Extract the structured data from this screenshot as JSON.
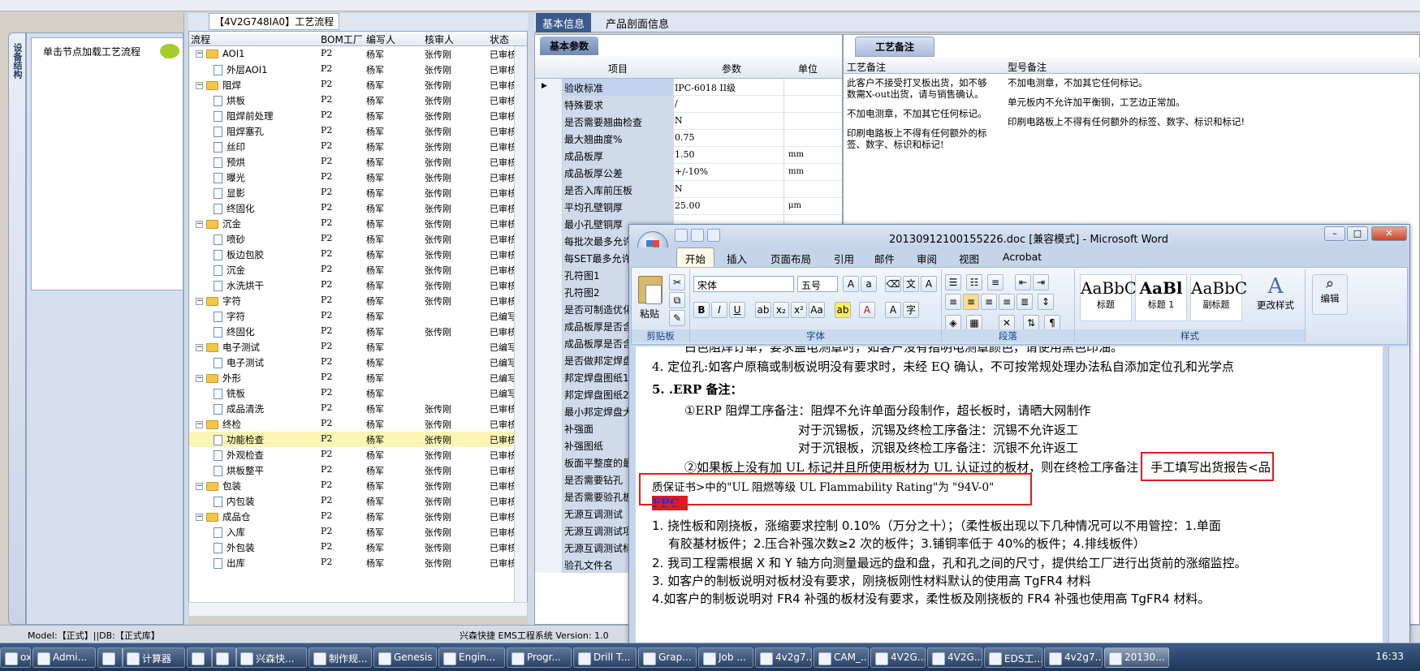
{
  "tree_caption": "【4V2G748IA0】工艺流程",
  "left_tab": "设备结构",
  "hint": "单击节点加载工艺流程",
  "tree_headers": [
    "流程",
    "BOM工厂",
    "编写人",
    "核审人",
    "状态"
  ],
  "tree_rows": [
    {
      "name": "AOI1",
      "type": "folder",
      "bom": "P2",
      "writer": "杨军",
      "reviewer": "张传刚",
      "status": "已审核"
    },
    {
      "name": "外层AOI1",
      "type": "doc",
      "bom": "P2",
      "writer": "杨军",
      "reviewer": "张传刚",
      "status": "已审核"
    },
    {
      "name": "阻焊",
      "type": "folder",
      "bom": "P2",
      "writer": "杨军",
      "reviewer": "张传刚",
      "status": "已审核"
    },
    {
      "name": "烘板",
      "type": "doc",
      "bom": "P2",
      "writer": "杨军",
      "reviewer": "张传刚",
      "status": "已审核"
    },
    {
      "name": "阻焊前处理",
      "type": "doc",
      "bom": "P2",
      "writer": "杨军",
      "reviewer": "张传刚",
      "status": "已审核"
    },
    {
      "name": "阻焊塞孔",
      "type": "doc",
      "bom": "P2",
      "writer": "杨军",
      "reviewer": "张传刚",
      "status": "已审核"
    },
    {
      "name": "丝印",
      "type": "doc",
      "bom": "P2",
      "writer": "杨军",
      "reviewer": "张传刚",
      "status": "已审核"
    },
    {
      "name": "预烘",
      "type": "doc",
      "bom": "P2",
      "writer": "杨军",
      "reviewer": "张传刚",
      "status": "已审核"
    },
    {
      "name": "曝光",
      "type": "doc",
      "bom": "P2",
      "writer": "杨军",
      "reviewer": "张传刚",
      "status": "已审核"
    },
    {
      "name": "显影",
      "type": "doc",
      "bom": "P2",
      "writer": "杨军",
      "reviewer": "张传刚",
      "status": "已审核"
    },
    {
      "name": "终固化",
      "type": "doc",
      "bom": "P2",
      "writer": "杨军",
      "reviewer": "张传刚",
      "status": "已审核"
    },
    {
      "name": "沉金",
      "type": "folder",
      "bom": "P2",
      "writer": "杨军",
      "reviewer": "张传刚",
      "status": "已审核"
    },
    {
      "name": "喷砂",
      "type": "doc",
      "bom": "P2",
      "writer": "杨军",
      "reviewer": "张传刚",
      "status": "已审核"
    },
    {
      "name": "板边包胶",
      "type": "doc",
      "bom": "P2",
      "writer": "杨军",
      "reviewer": "张传刚",
      "status": "已审核"
    },
    {
      "name": "沉金",
      "type": "doc",
      "bom": "P2",
      "writer": "杨军",
      "reviewer": "张传刚",
      "status": "已审核"
    },
    {
      "name": "水洗烘干",
      "type": "doc",
      "bom": "P2",
      "writer": "杨军",
      "reviewer": "张传刚",
      "status": "已审核"
    },
    {
      "name": "字符",
      "type": "folder",
      "bom": "P2",
      "writer": "杨军",
      "reviewer": "张传刚",
      "status": "已审核"
    },
    {
      "name": "字符",
      "type": "doc",
      "bom": "P2",
      "writer": "杨军",
      "reviewer": "",
      "status": "已编写"
    },
    {
      "name": "终固化",
      "type": "doc",
      "bom": "P2",
      "writer": "杨军",
      "reviewer": "张传刚",
      "status": "已审核"
    },
    {
      "name": "电子测试",
      "type": "folder",
      "bom": "P2",
      "writer": "杨军",
      "reviewer": "",
      "status": "已编写"
    },
    {
      "name": "电子测试",
      "type": "doc",
      "bom": "P2",
      "writer": "杨军",
      "reviewer": "",
      "status": "已编写"
    },
    {
      "name": "外形",
      "type": "folder",
      "bom": "P2",
      "writer": "杨军",
      "reviewer": "",
      "status": "已编写"
    },
    {
      "name": "铣板",
      "type": "doc",
      "bom": "P2",
      "writer": "杨军",
      "reviewer": "",
      "status": "已编写"
    },
    {
      "name": "成品清洗",
      "type": "doc",
      "bom": "P2",
      "writer": "杨军",
      "reviewer": "张传刚",
      "status": "已审核"
    },
    {
      "name": "终检",
      "type": "folder",
      "bom": "P2",
      "writer": "杨军",
      "reviewer": "张传刚",
      "status": "已审核"
    },
    {
      "name": "功能检查",
      "type": "doc",
      "bom": "P2",
      "writer": "杨军",
      "reviewer": "张传刚",
      "status": "已审核",
      "selected": true
    },
    {
      "name": "外观检查",
      "type": "doc",
      "bom": "P2",
      "writer": "杨军",
      "reviewer": "张传刚",
      "status": "已审核"
    },
    {
      "name": "烘板整平",
      "type": "doc",
      "bom": "P2",
      "writer": "杨军",
      "reviewer": "张传刚",
      "status": "已审核"
    },
    {
      "name": "包装",
      "type": "folder",
      "bom": "P2",
      "writer": "杨军",
      "reviewer": "张传刚",
      "status": "已审核"
    },
    {
      "name": "内包装",
      "type": "doc",
      "bom": "P2",
      "writer": "杨军",
      "reviewer": "张传刚",
      "status": "已审核"
    },
    {
      "name": "成品仓",
      "type": "folder",
      "bom": "P2",
      "writer": "杨军",
      "reviewer": "张传刚",
      "status": "已审核"
    },
    {
      "name": "入库",
      "type": "doc",
      "bom": "P2",
      "writer": "杨军",
      "reviewer": "张传刚",
      "status": "已审核"
    },
    {
      "name": "外包装",
      "type": "doc",
      "bom": "P2",
      "writer": "杨军",
      "reviewer": "张传刚",
      "status": "已审核"
    },
    {
      "name": "出库",
      "type": "doc",
      "bom": "P2",
      "writer": "杨军",
      "reviewer": "张传刚",
      "status": "已审核"
    }
  ],
  "status_bar": {
    "left": "Model:【正式】||DB:【正式库】",
    "right": "兴森快捷 EMS工程系统 Version: 1.0"
  },
  "right_tabs": [
    "基本信息",
    "产品剖面信息"
  ],
  "params": {
    "tab": "基本参数",
    "headers": [
      "项目",
      "参数",
      "单位"
    ],
    "rows": [
      {
        "k": "验收标准",
        "v": "IPC-6018 II级",
        "u": ""
      },
      {
        "k": "特殊要求",
        "v": "/",
        "u": ""
      },
      {
        "k": "是否需要翘曲检查",
        "v": "N",
        "u": ""
      },
      {
        "k": "最大翘曲度%",
        "v": "0.75",
        "u": ""
      },
      {
        "k": "成品板厚",
        "v": "1.50",
        "u": "mm"
      },
      {
        "k": "成品板厚公差",
        "v": "+/-10%",
        "u": "mm"
      },
      {
        "k": "是否入库前压板",
        "v": "N",
        "u": ""
      },
      {
        "k": "平均孔壁铜厚",
        "v": "25.00",
        "u": "μm"
      },
      {
        "k": "最小孔壁铜厚",
        "v": "",
        "u": ""
      },
      {
        "k": "每批次最多允许",
        "v": "",
        "u": ""
      },
      {
        "k": "每SET最多允许",
        "v": "",
        "u": ""
      },
      {
        "k": "孔符图1",
        "v": "",
        "u": ""
      },
      {
        "k": "孔符图2",
        "v": "",
        "u": ""
      },
      {
        "k": "是否可制造优化",
        "v": "",
        "u": ""
      },
      {
        "k": "成品板厚是否含",
        "v": "",
        "u": ""
      },
      {
        "k": "成品板厚是否含",
        "v": "",
        "u": ""
      },
      {
        "k": "是否做邦定焊盘",
        "v": "",
        "u": ""
      },
      {
        "k": "邦定焊盘图纸1",
        "v": "",
        "u": ""
      },
      {
        "k": "邦定焊盘图纸2",
        "v": "",
        "u": ""
      },
      {
        "k": "最小邦定焊盘大",
        "v": "",
        "u": ""
      },
      {
        "k": "补强面",
        "v": "",
        "u": ""
      },
      {
        "k": "补强图纸",
        "v": "",
        "u": ""
      },
      {
        "k": "板面平整度的最",
        "v": "",
        "u": ""
      },
      {
        "k": "是否需要钻孔",
        "v": "",
        "u": ""
      },
      {
        "k": "是否需要验孔板",
        "v": "",
        "u": ""
      },
      {
        "k": "无源互调测试",
        "v": "",
        "u": ""
      },
      {
        "k": "无源互调测试项",
        "v": "",
        "u": ""
      },
      {
        "k": "无源互调测试标",
        "v": "",
        "u": ""
      },
      {
        "k": "验孔文件名",
        "v": "",
        "u": ""
      }
    ]
  },
  "remark": {
    "tab": "工艺备注",
    "col1_header": "工艺备注",
    "col2_header": "型号备注",
    "col1": [
      "此客户不接受打叉板出货，如不够数需X-out出货，请与销售确认。",
      "不加电测章，不加其它任何标记。",
      "印刷电路板上不得有任何额外的标签、数字、标识和标记!"
    ],
    "col2": [
      "不加电测章，不加其它任何标记。",
      "单元板内不允许加平衡铜，工艺边正常加。",
      "印刷电路板上不得有任何额外的标签、数字、标识和标记!"
    ]
  },
  "word": {
    "title": "20130912100155226.doc [兼容模式] - Microsoft Word",
    "tabs": [
      "开始",
      "插入",
      "页面布局",
      "引用",
      "邮件",
      "审阅",
      "视图",
      "Acrobat"
    ],
    "font_name": "宋体",
    "font_size": "五号",
    "groups": [
      "剪贴板",
      "字体",
      "段落",
      "样式"
    ],
    "paste": "粘贴",
    "styles": [
      {
        "p": "AaBbC",
        "n": "标题"
      },
      {
        "p": "AaBl",
        "n": "标题 1"
      },
      {
        "p": "AaBbC",
        "n": "副标题"
      }
    ],
    "change_style": "更改样式",
    "edit": "编辑",
    "lines": [
      "白色阻焊订单，要求盖电测章时，如客户没有指明电测章颜色，请使用黑色印油。",
      "4.  定位孔:如客户原稿或制板说明没有要求时，未经 EQ 确认，不可按常规处理办法私自添加定位孔和光学点",
      "5. .ERP 备注：",
      "①ERP 阻焊工序备注：阻焊不允许单面分段制作，超长板时，请晒大网制作",
      "对于沉锡板，沉锡及终检工序备注：沉锡不允许返工",
      "对于沉银板，沉银及终检工序备注：沉银不允许返工",
      "②如果板上没有加 UL 标记并且所使用板材为 UL 认证过的板材，则在终检工序备注：手工填写出货报告<品",
      "质保证书>中的\"UL 阻燃等级 UL Flammability Rating\"为 \"94V-0\"",
      "FPC",
      "1.   挠性板和刚挠板，涨缩要求控制  0.10%（万分之十）；（柔性板出现以下几种情况可以不用管控：1.单面",
      "有胶基材板件；2.压合补强次数≥2 次的板件；3.铺铜率低于 40%的板件；4.排线板件）",
      "2.   我司工程需根据 X 和 Y 轴方向测量最远的盘和盘，孔和孔之间的尺寸，提供给工厂进行出货前的涨缩监控。",
      "3. 如客户的制板说明对板材没有要求，刚挠板刚性材料默认的使用高 TgFR4 材料",
      "4.如客户的制板说明对 FR4 补强的板材没有要求，柔性板及刚挠板的 FR4 补强也使用高 TgFR4 材料。"
    ]
  },
  "taskbar": [
    "oxmail",
    "Admi...",
    "",
    "计算器",
    "",
    "",
    "兴森快...",
    "制作规...",
    "Genesis",
    "Engin...",
    "Progr...",
    "Drill T...",
    "Grap...",
    "Job ...",
    "4v2g7...",
    "CAM_...",
    "4V2G...",
    "4V2G...",
    "EDS工...",
    "4v2g7...",
    "20130..."
  ],
  "clock": "16:33"
}
